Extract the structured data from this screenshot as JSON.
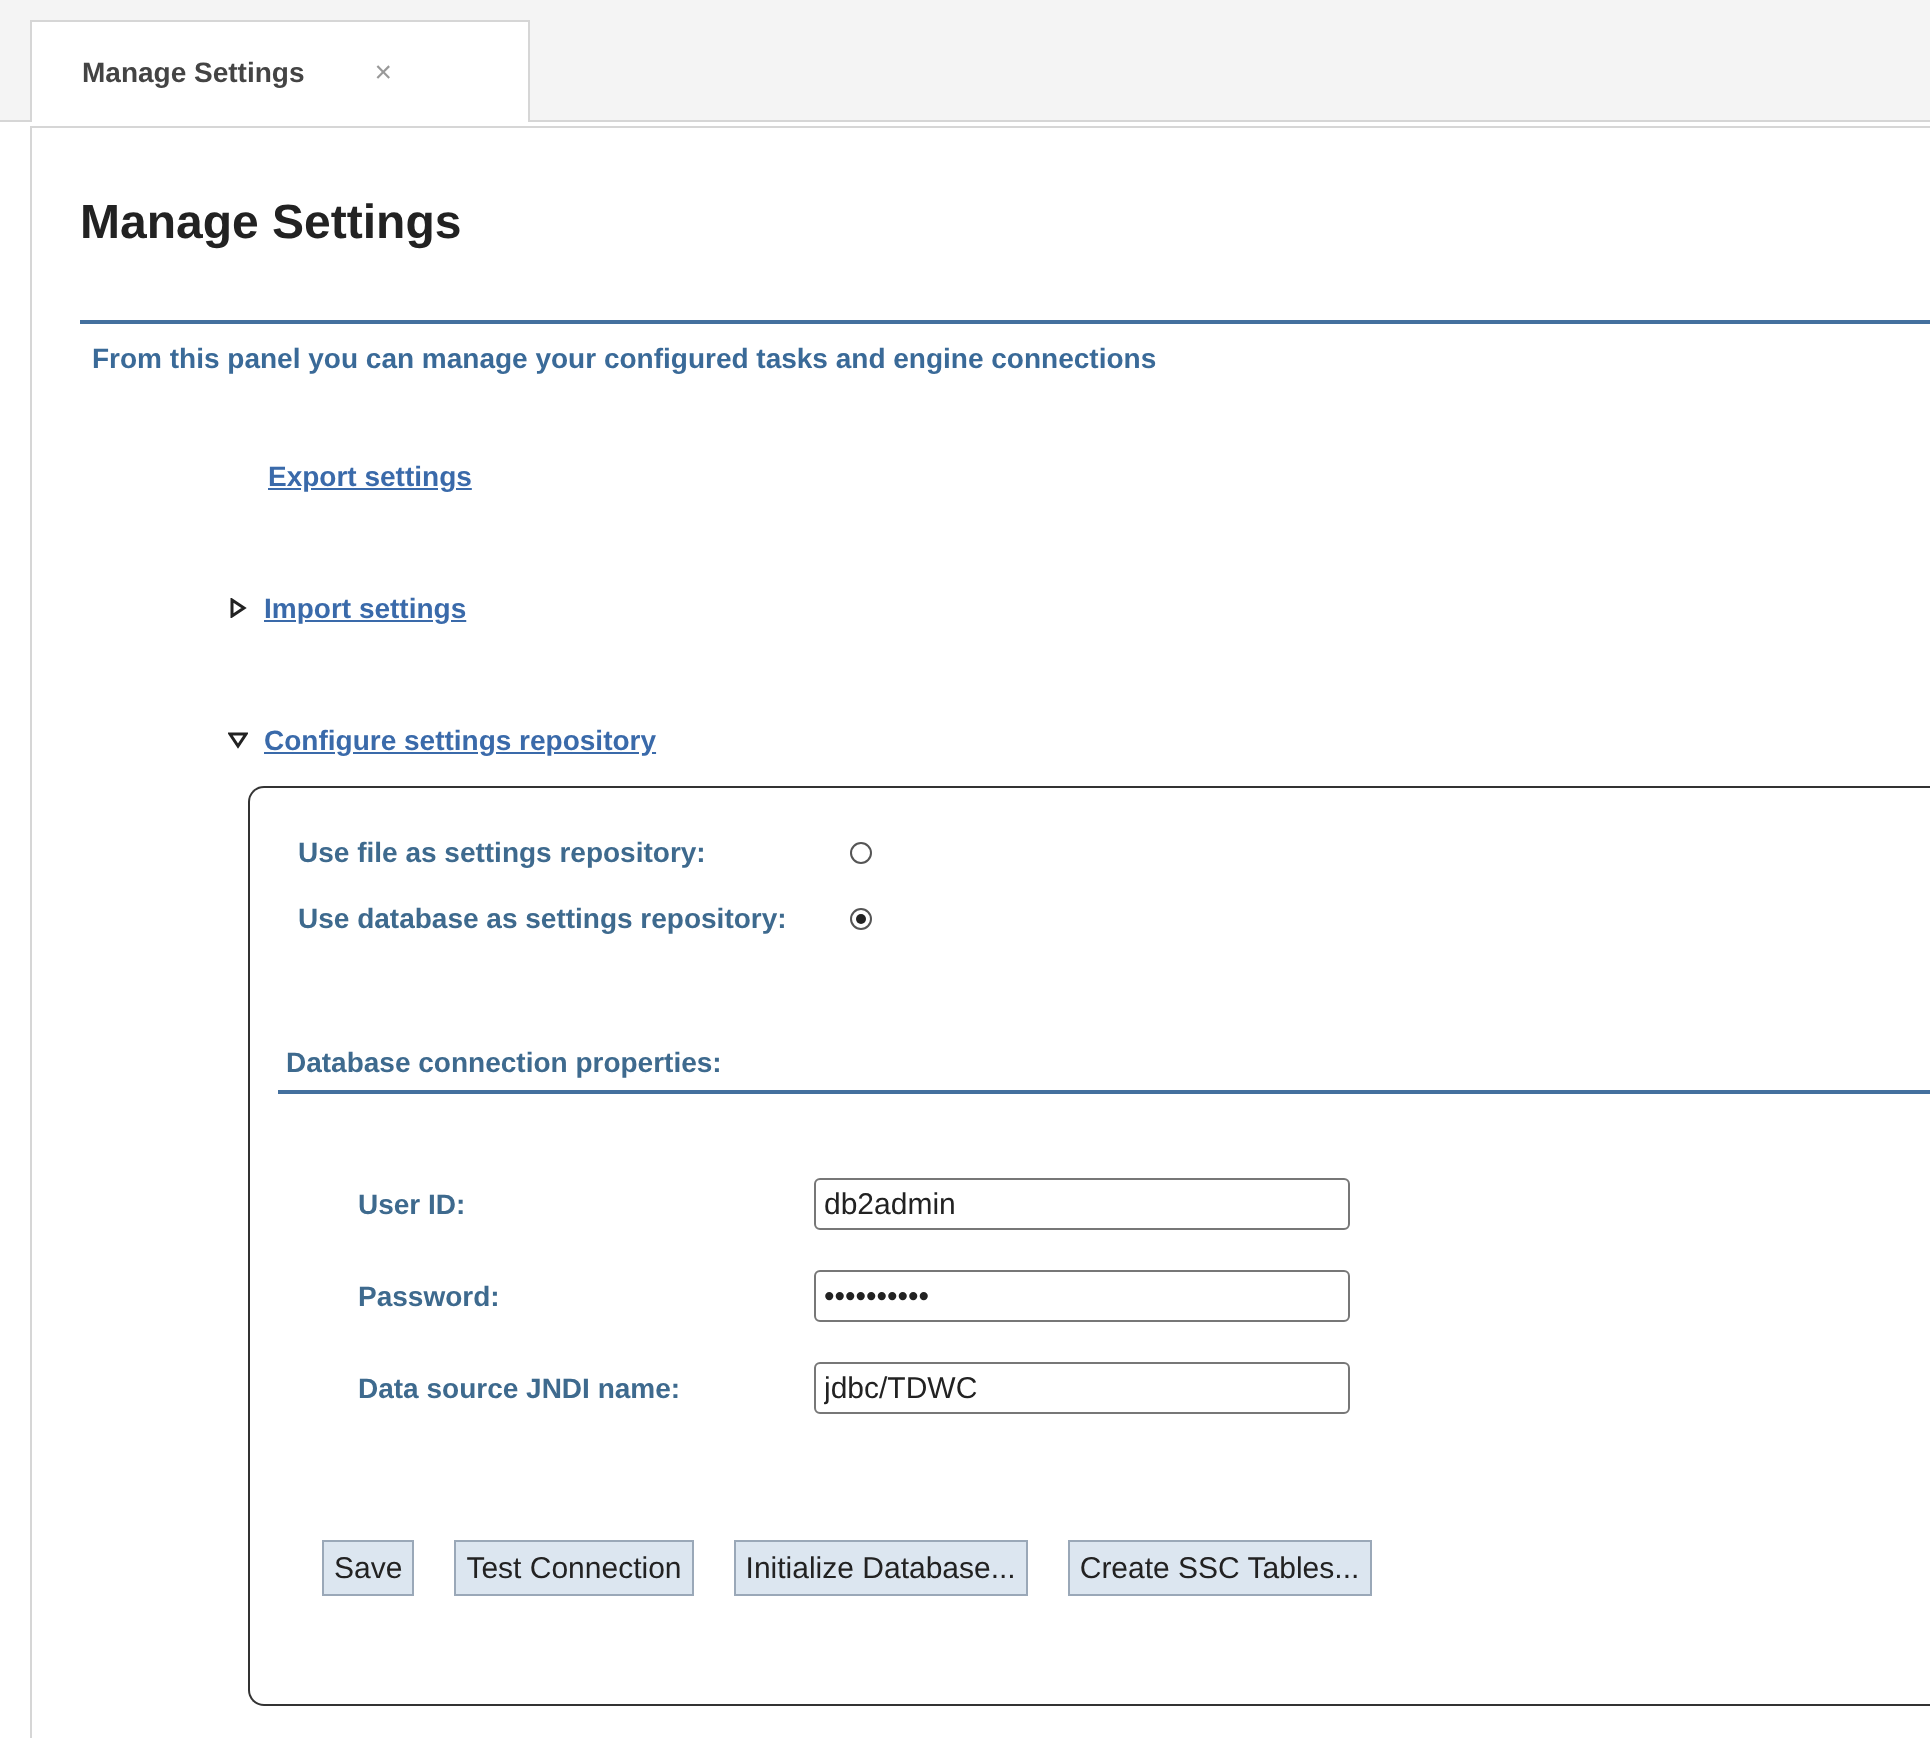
{
  "tabs": [
    {
      "label": "Manage Settings",
      "close": "×",
      "selected": true
    }
  ],
  "panel": {
    "title": "Manage Settings",
    "description": "From this panel you can manage your configured tasks and engine connections",
    "sections": [
      {
        "kind": "link",
        "label": "Export settings"
      },
      {
        "kind": "expander",
        "label": "Import settings",
        "expanded": false
      },
      {
        "kind": "expander",
        "label": "Configure settings repository",
        "expanded": true
      }
    ],
    "repository_options": [
      {
        "label": "Use file as settings repository:",
        "selected": false
      },
      {
        "label": "Use database as settings repository:",
        "selected": true
      }
    ],
    "connection_heading": "Database connection properties:",
    "fields": [
      {
        "label": "User ID:",
        "value": "db2admin"
      },
      {
        "label": "Password:",
        "value": "••••••••••"
      },
      {
        "label": "Data source JNDI name:",
        "value": "jdbc/TDWC"
      }
    ],
    "buttons": [
      "Save",
      "Test Connection",
      "Initialize Database...",
      "Create SSC Tables..."
    ]
  }
}
